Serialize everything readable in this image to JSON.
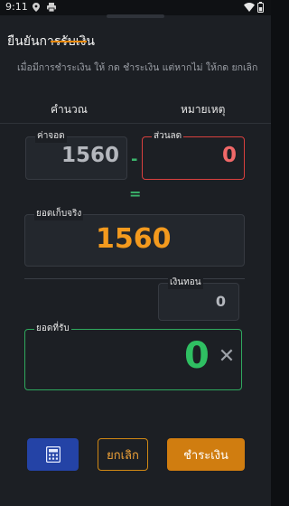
{
  "status_bar": {
    "time": "9:11",
    "icons": [
      "location-icon",
      "printer-icon",
      "wifi-icon",
      "battery-icon"
    ]
  },
  "dialog": {
    "title": "ยืนยันการรับเงิน",
    "description": "เมื่อมีการชำระเงิน ให้ กด ชำระเงิน  แต่หากไม่ ให้กด ยกเลิก"
  },
  "tabs": [
    {
      "label": "คำนวณ",
      "active": true
    },
    {
      "label": "หมายเหตุ",
      "active": false
    }
  ],
  "calc": {
    "total_label": "ค่าจอด",
    "total_value": "1560",
    "minus_symbol": "-",
    "discount_label": "ส่วนลด",
    "discount_value": "0",
    "equals_symbol": "=",
    "net_label": "ยอดเก็บจริง",
    "net_value": "1560",
    "change_label": "เงินทอน",
    "change_value": "0",
    "received_label": "ยอดที่รับ",
    "received_value": "0",
    "clear_symbol": "✕"
  },
  "buttons": {
    "calculator_icon": "calculator-icon",
    "cancel_label": "ยกเลิก",
    "pay_label": "ชำระเงิน"
  },
  "colors": {
    "accent_orange": "#d07d10",
    "net_amount": "#f39a1e",
    "discount_red": "#f06868",
    "received_green": "#2fbf62",
    "calculator_blue": "#2443a6"
  }
}
